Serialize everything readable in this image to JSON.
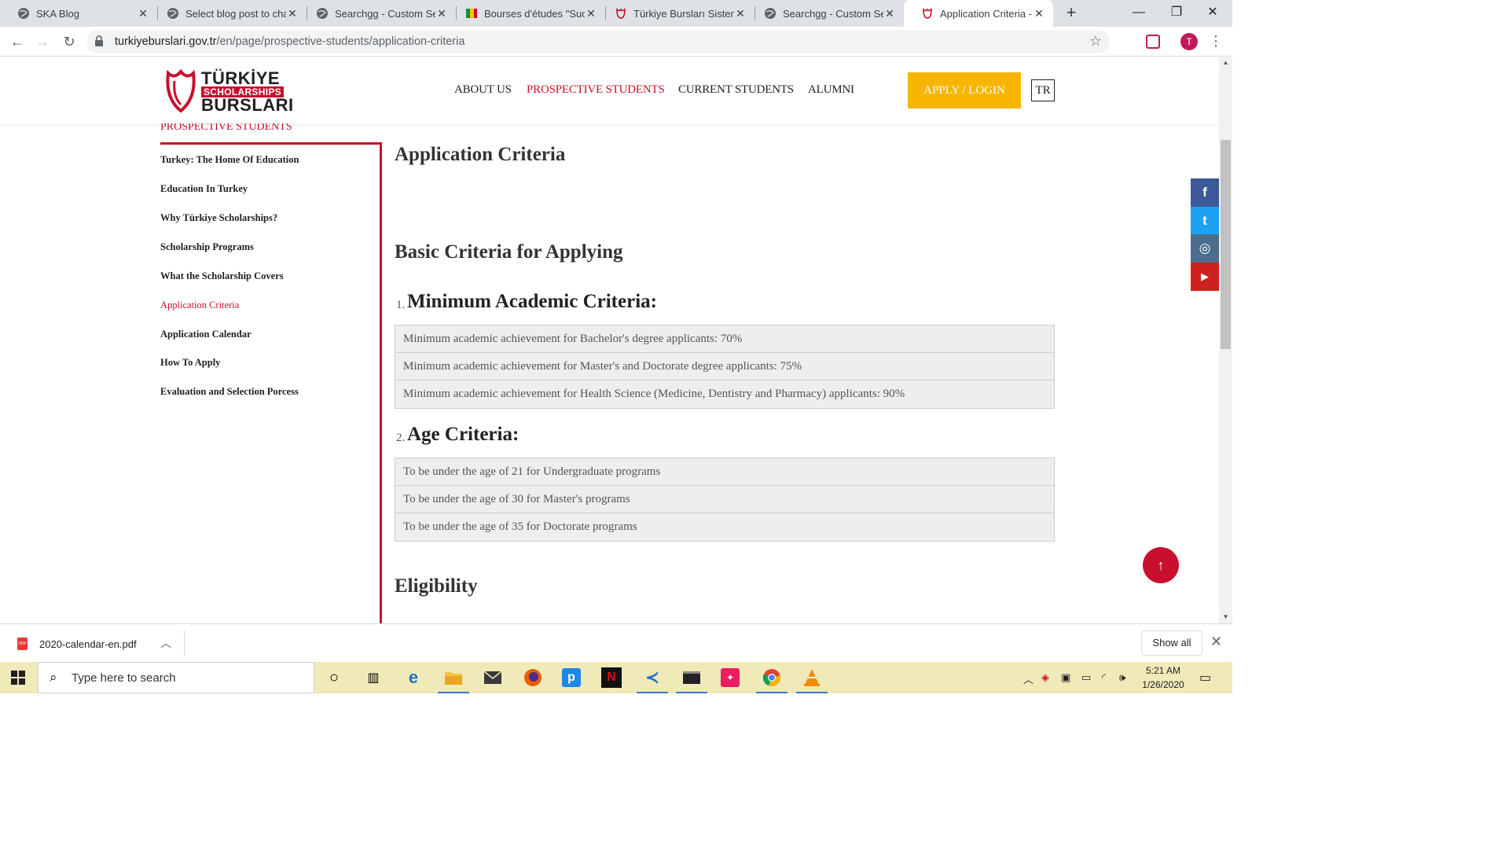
{
  "browser": {
    "tabs": [
      {
        "title": "SKA Blog",
        "active": false
      },
      {
        "title": "Select blog post to cha",
        "active": false
      },
      {
        "title": "Searchgg - Custom Sea",
        "active": false
      },
      {
        "title": "Bourses d'études \"Succ",
        "active": false
      },
      {
        "title": "Türkiye Bursları Sistemi",
        "active": false
      },
      {
        "title": "Searchgg - Custom Sea",
        "active": false
      },
      {
        "title": "Application Criteria - P",
        "active": true
      }
    ],
    "new_tab_label": "+",
    "url_domain": "turkiyeburslari.gov.tr",
    "url_path": "/en/page/prospective-students/application-criteria",
    "profile_initial": "T",
    "icons": {
      "back": "arrow-left-icon",
      "forward": "arrow-right-icon",
      "reload": "reload-icon",
      "lock": "lock-icon",
      "bookmark": "star-icon",
      "menu": "kebab-menu-icon"
    }
  },
  "site": {
    "logo": {
      "line1": "TÜRKİYE",
      "line2": "SCHOLARSHIPS",
      "line3": "BURSLARI"
    },
    "nav": [
      {
        "label": "ABOUT US",
        "active": false
      },
      {
        "label": "PROSPECTIVE STUDENTS",
        "active": true
      },
      {
        "label": "CURRENT STUDENTS",
        "active": false
      },
      {
        "label": "ALUMNI",
        "active": false
      }
    ],
    "apply_label": "APPLY / LOGIN",
    "lang_label": "TR",
    "accent_color": "#c8102e",
    "apply_color": "#f7b500"
  },
  "sidebar": {
    "heading": "PROSPECTIVE STUDENTS",
    "items": [
      {
        "label": "Turkey: The Home Of Education",
        "active": false
      },
      {
        "label": "Education In Turkey",
        "active": false
      },
      {
        "label": "Why Türkiye Scholarships?",
        "active": false
      },
      {
        "label": "Scholarship Programs",
        "active": false
      },
      {
        "label": "What the Scholarship Covers",
        "active": false
      },
      {
        "label": "Application Criteria",
        "active": true
      },
      {
        "label": "Application Calendar",
        "active": false
      },
      {
        "label": "How To Apply",
        "active": false
      },
      {
        "label": "Evaluation and Selection Porcess",
        "active": false
      }
    ]
  },
  "main": {
    "page_title": "Application Criteria",
    "section_basic": "Basic Criteria for Applying",
    "academic": {
      "number": "1.",
      "title": "Minimum Academic Criteria:",
      "rows": [
        "Minimum academic achievement for Bachelor's degree applicants: 70%",
        "Minimum academic achievement for Master's and Doctorate degree applicants: 75%",
        "Minimum academic achievement for Health Science (Medicine, Dentistry and Pharmacy) applicants: 90%"
      ]
    },
    "age": {
      "number": "2.",
      "title": "Age Criteria:",
      "rows": [
        "To be under the age of 21 for Undergraduate programs",
        "To be under the age of 30 for Master's programs",
        "To be under the age of 35 for Doctorate programs"
      ]
    },
    "section_eligibility": "Eligibility"
  },
  "social": [
    {
      "name": "facebook-icon",
      "glyph": "f",
      "color": "#3b5998"
    },
    {
      "name": "twitter-icon",
      "glyph": "t",
      "color": "#1da1f2"
    },
    {
      "name": "instagram-icon",
      "glyph": "◎",
      "color": "#4a6d8c"
    },
    {
      "name": "youtube-icon",
      "glyph": "▶",
      "color": "#cd201f"
    }
  ],
  "back_to_top_glyph": "↑",
  "downloads": {
    "file_name": "2020-calendar-en.pdf",
    "file_badge": "PDF",
    "show_all_label": "Show all"
  },
  "taskbar": {
    "search_placeholder": "Type here to search",
    "time": "5:21 AM",
    "date": "1/26/2020"
  }
}
